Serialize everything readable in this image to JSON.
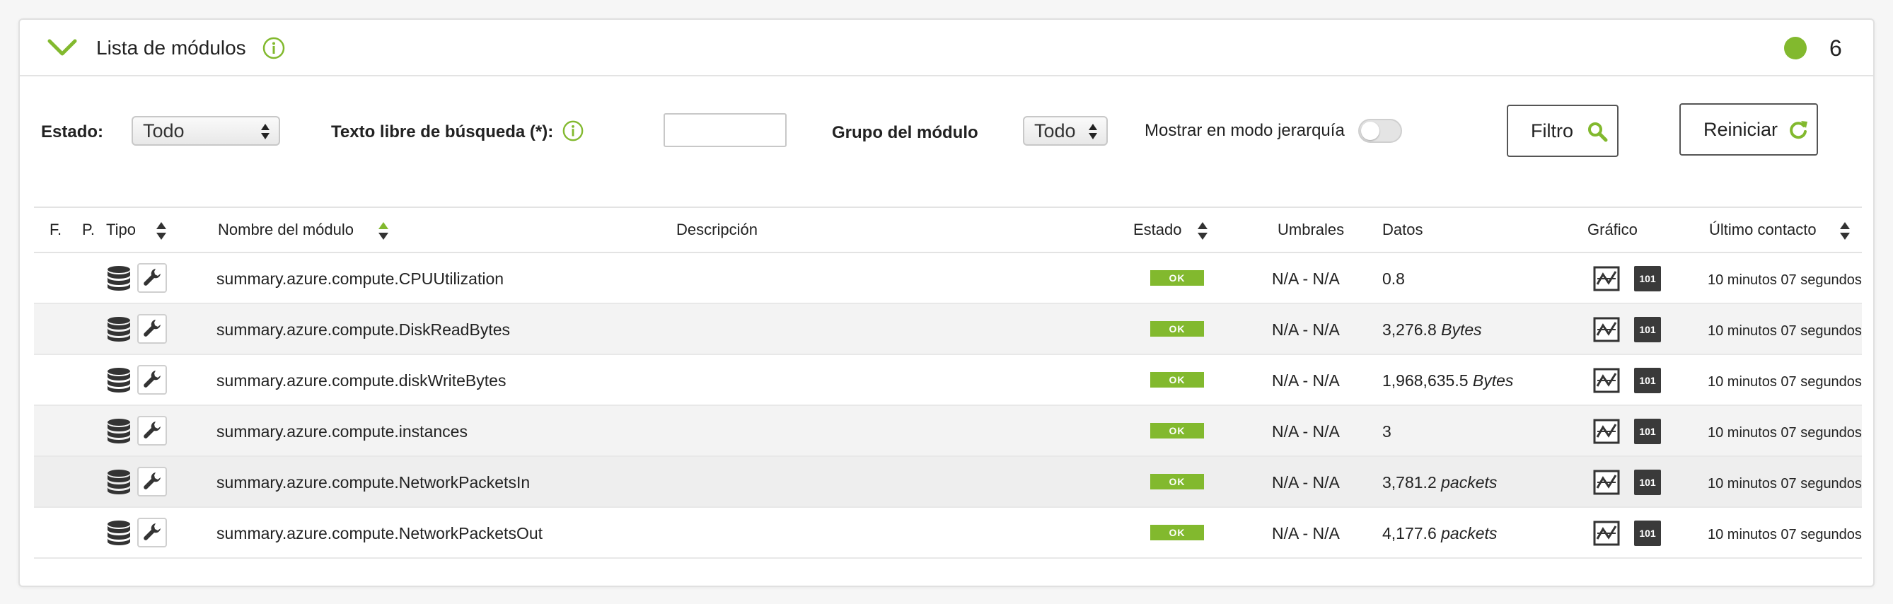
{
  "header": {
    "title": "Lista de módulos",
    "count": "6",
    "status_color": "#82b92e",
    "accent": "#82b92e"
  },
  "filters": {
    "estado_label": "Estado:",
    "estado_value": "Todo",
    "search_label": "Texto libre de búsqueda (*):",
    "search_value": "",
    "group_label": "Grupo del módulo",
    "group_value": "Todo",
    "hierarchy_label": "Mostrar en modo jerarquía",
    "filter_button": "Filtro",
    "reset_button": "Reiniciar"
  },
  "table": {
    "columns": {
      "f": "F.",
      "p": "P.",
      "tipo": "Tipo",
      "nombre": "Nombre del módulo",
      "descripcion": "Descripción",
      "estado": "Estado",
      "umbrales": "Umbrales",
      "datos": "Datos",
      "grafico": "Gráfico",
      "ultimo": "Último contacto"
    },
    "rows": [
      {
        "name": "summary.azure.compute.CPUUtilization",
        "status": "OK",
        "thresholds": "N/A - N/A",
        "value": "0.8",
        "unit": "",
        "graph_label": "101",
        "contact": "10 minutos 07 segundos"
      },
      {
        "name": "summary.azure.compute.DiskReadBytes",
        "status": "OK",
        "thresholds": "N/A - N/A",
        "value": "3,276.8",
        "unit": "Bytes",
        "graph_label": "101",
        "contact": "10 minutos 07 segundos"
      },
      {
        "name": "summary.azure.compute.diskWriteBytes",
        "status": "OK",
        "thresholds": "N/A - N/A",
        "value": "1,968,635.5",
        "unit": "Bytes",
        "graph_label": "101",
        "contact": "10 minutos 07 segundos"
      },
      {
        "name": "summary.azure.compute.instances",
        "status": "OK",
        "thresholds": "N/A - N/A",
        "value": "3",
        "unit": "",
        "graph_label": "101",
        "contact": "10 minutos 07 segundos"
      },
      {
        "name": "summary.azure.compute.NetworkPacketsIn",
        "status": "OK",
        "thresholds": "N/A - N/A",
        "value": "3,781.2",
        "unit": "packets",
        "graph_label": "101",
        "contact": "10 minutos 07 segundos"
      },
      {
        "name": "summary.azure.compute.NetworkPacketsOut",
        "status": "OK",
        "thresholds": "N/A - N/A",
        "value": "4,177.6",
        "unit": "packets",
        "graph_label": "101",
        "contact": "10 minutos 07 segundos"
      }
    ]
  }
}
